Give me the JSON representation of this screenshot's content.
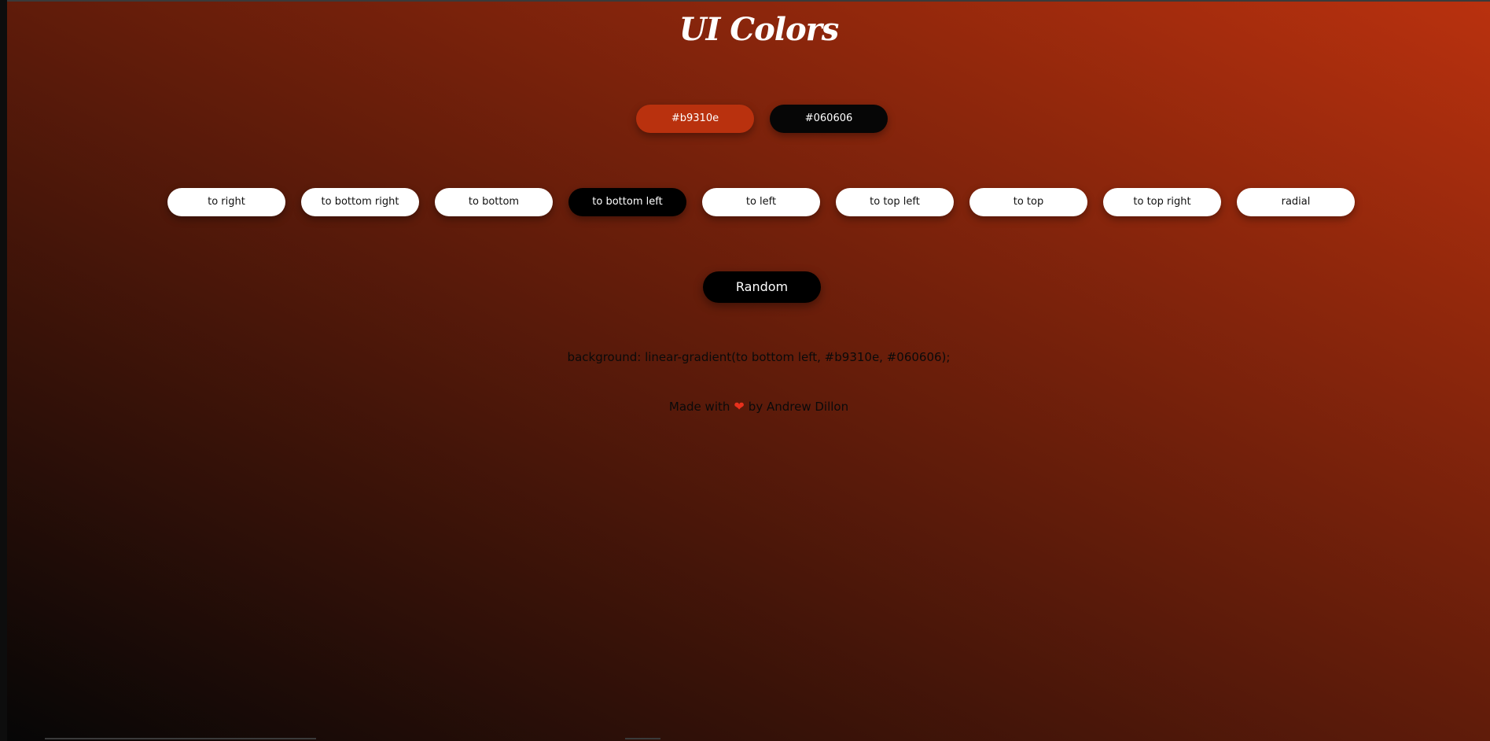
{
  "title": "UI Colors",
  "colors": {
    "first": "#b9310e",
    "second": "#060606"
  },
  "directions": [
    {
      "label": "to right",
      "active": false
    },
    {
      "label": "to bottom right",
      "active": false
    },
    {
      "label": "to bottom",
      "active": false
    },
    {
      "label": "to bottom left",
      "active": true
    },
    {
      "label": "to left",
      "active": false
    },
    {
      "label": "to top left",
      "active": false
    },
    {
      "label": "to top",
      "active": false
    },
    {
      "label": "to top right",
      "active": false
    },
    {
      "label": "radial",
      "active": false
    }
  ],
  "random_label": "Random",
  "css_output": "background: linear-gradient(to bottom left, #b9310e, #060606);",
  "credit": {
    "prefix": "Made with",
    "icon": "heart-icon",
    "suffix": "by Andrew Dillon"
  },
  "accent_colors": {
    "heart": "#e8301c",
    "active_button": "#000000",
    "inactive_button": "#ffffff"
  }
}
